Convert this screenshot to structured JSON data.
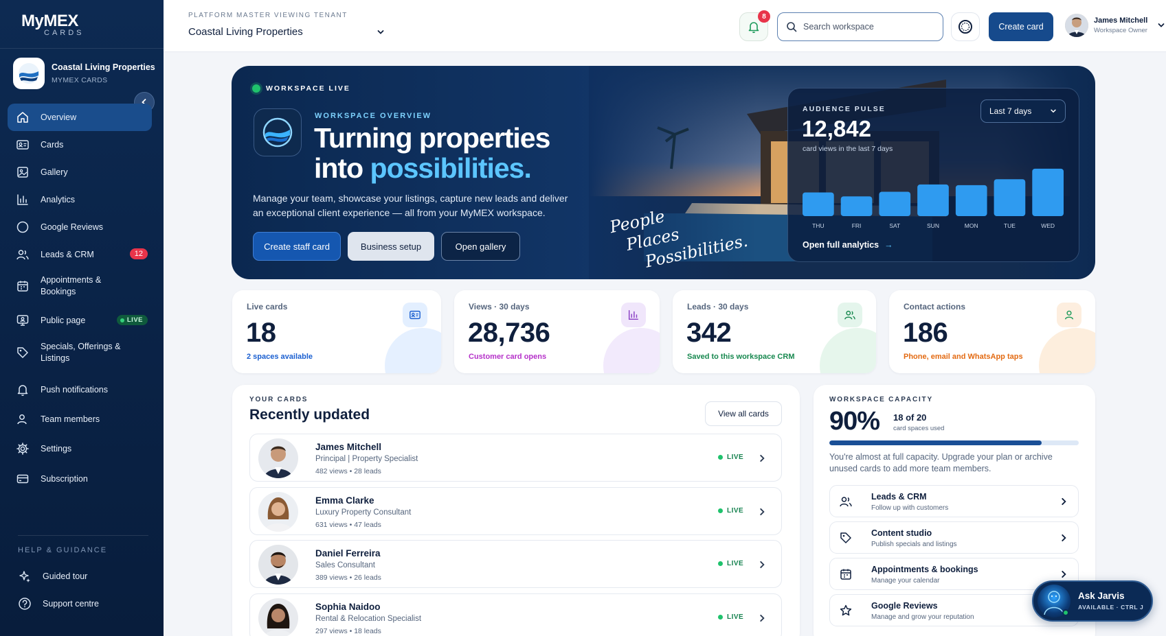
{
  "brand": {
    "logo_main": "MyMEX",
    "logo_sub": "CARDS"
  },
  "tenant": {
    "name": "Coastal Living Properties",
    "sub": "MYMEX CARDS"
  },
  "sidebar": {
    "items": [
      {
        "label": "Overview",
        "icon": "home-icon"
      },
      {
        "label": "Cards",
        "icon": "id-card-icon"
      },
      {
        "label": "Gallery",
        "icon": "image-icon"
      },
      {
        "label": "Analytics",
        "icon": "bar-chart-icon"
      },
      {
        "label": "Google Reviews",
        "icon": "circle-icon"
      },
      {
        "label": "Leads & CRM",
        "icon": "users-icon",
        "badge": "12"
      },
      {
        "label": "Appointments & Bookings",
        "icon": "calendar-icon"
      },
      {
        "label": "Public page",
        "icon": "monitor-user-icon",
        "badge": "LIVE"
      },
      {
        "label": "Specials, Offerings & Listings",
        "icon": "tag-icon"
      },
      {
        "label": "Push notifications",
        "icon": "bell-icon"
      },
      {
        "label": "Team members",
        "icon": "user-icon"
      },
      {
        "label": "Settings",
        "icon": "gear-icon"
      },
      {
        "label": "Subscription",
        "icon": "credit-card-icon"
      }
    ],
    "help_title": "HELP & GUIDANCE",
    "help_items": [
      {
        "label": "Guided tour",
        "icon": "sparkle-icon"
      },
      {
        "label": "Support centre",
        "icon": "help-circle-icon"
      }
    ]
  },
  "topbar": {
    "tenant_label": "PLATFORM MASTER VIEWING TENANT",
    "tenant_value": "Coastal Living Properties",
    "notifications_count": "8",
    "search_placeholder": "Search workspace",
    "create_label": "Create card",
    "user_name": "James Mitchell",
    "user_role": "Workspace Owner"
  },
  "hero": {
    "status": "WORKSPACE LIVE",
    "kicker": "WORKSPACE OVERVIEW",
    "title_line1": "Turning properties",
    "title_into": "into ",
    "title_accent": "possibilities.",
    "description": "Manage your team, showcase your listings, capture new leads and deliver an exceptional client experience — all from your MyMEX workspace.",
    "btn_primary": "Create staff card",
    "btn_secondary": "Business setup",
    "btn_tertiary": "Open gallery",
    "script_1": "People",
    "script_2": "Places",
    "script_3": "Possibilities."
  },
  "pulse": {
    "title": "AUDIENCE PULSE",
    "value": "12,842",
    "sub": "card views in the last 7 days",
    "range": "Last 7 days",
    "link": "Open full analytics",
    "link_arrow": "→"
  },
  "chart_data": {
    "type": "bar",
    "categories": [
      "THU",
      "FRI",
      "SAT",
      "SUN",
      "MON",
      "TUE",
      "WED"
    ],
    "values": [
      36,
      30,
      37,
      48,
      47,
      56,
      72
    ],
    "ylim": [
      0,
      75
    ],
    "grid": false,
    "color": "#2f9bf0"
  },
  "stats": [
    {
      "title": "Live cards",
      "value": "18",
      "sub": "2 spaces available",
      "sub_color": "#1a5fd0",
      "icon": "id-card-icon"
    },
    {
      "title": "Views · 30 days",
      "value": "28,736",
      "sub": "Customer card opens",
      "sub_color": "#b531c9",
      "icon": "bar-chart-icon"
    },
    {
      "title": "Leads · 30 days",
      "value": "342",
      "sub": "Saved to this workspace CRM",
      "sub_color": "#17884f",
      "icon": "users-icon"
    },
    {
      "title": "Contact actions",
      "value": "186",
      "sub": "Phone, email and WhatsApp taps",
      "sub_color": "#e36a12",
      "icon": "user-icon"
    }
  ],
  "recent": {
    "kicker": "YOUR CARDS",
    "title": "Recently updated",
    "view_all": "View all cards",
    "rows": [
      {
        "name": "James Mitchell",
        "role": "Principal | Property Specialist",
        "meta": "482 views • 28 leads",
        "status": "LIVE"
      },
      {
        "name": "Emma Clarke",
        "role": "Luxury Property Consultant",
        "meta": "631 views • 47 leads",
        "status": "LIVE"
      },
      {
        "name": "Daniel Ferreira",
        "role": "Sales Consultant",
        "meta": "389 views • 26 leads",
        "status": "LIVE"
      },
      {
        "name": "Sophia Naidoo",
        "role": "Rental & Relocation Specialist",
        "meta": "297 views • 18 leads",
        "status": "LIVE"
      }
    ]
  },
  "capacity": {
    "kicker": "WORKSPACE CAPACITY",
    "value": "90%",
    "of": "18 of 20",
    "used": "card spaces used",
    "fill_fraction": 0.85,
    "description": "You're almost at full capacity. Upgrade your plan or archive unused cards to add more team members.",
    "actions": [
      {
        "title": "Leads & CRM",
        "sub": "Follow up with customers",
        "icon": "users-icon"
      },
      {
        "title": "Content studio",
        "sub": "Publish specials and listings",
        "icon": "tag-icon"
      },
      {
        "title": "Appointments & bookings",
        "sub": "Manage your calendar",
        "icon": "calendar-icon"
      },
      {
        "title": "Google Reviews",
        "sub": "Manage and grow your reputation",
        "icon": "star-icon"
      }
    ]
  },
  "jarvis": {
    "title": "Ask Jarvis",
    "sub": "AVAILABLE · CTRL J"
  }
}
